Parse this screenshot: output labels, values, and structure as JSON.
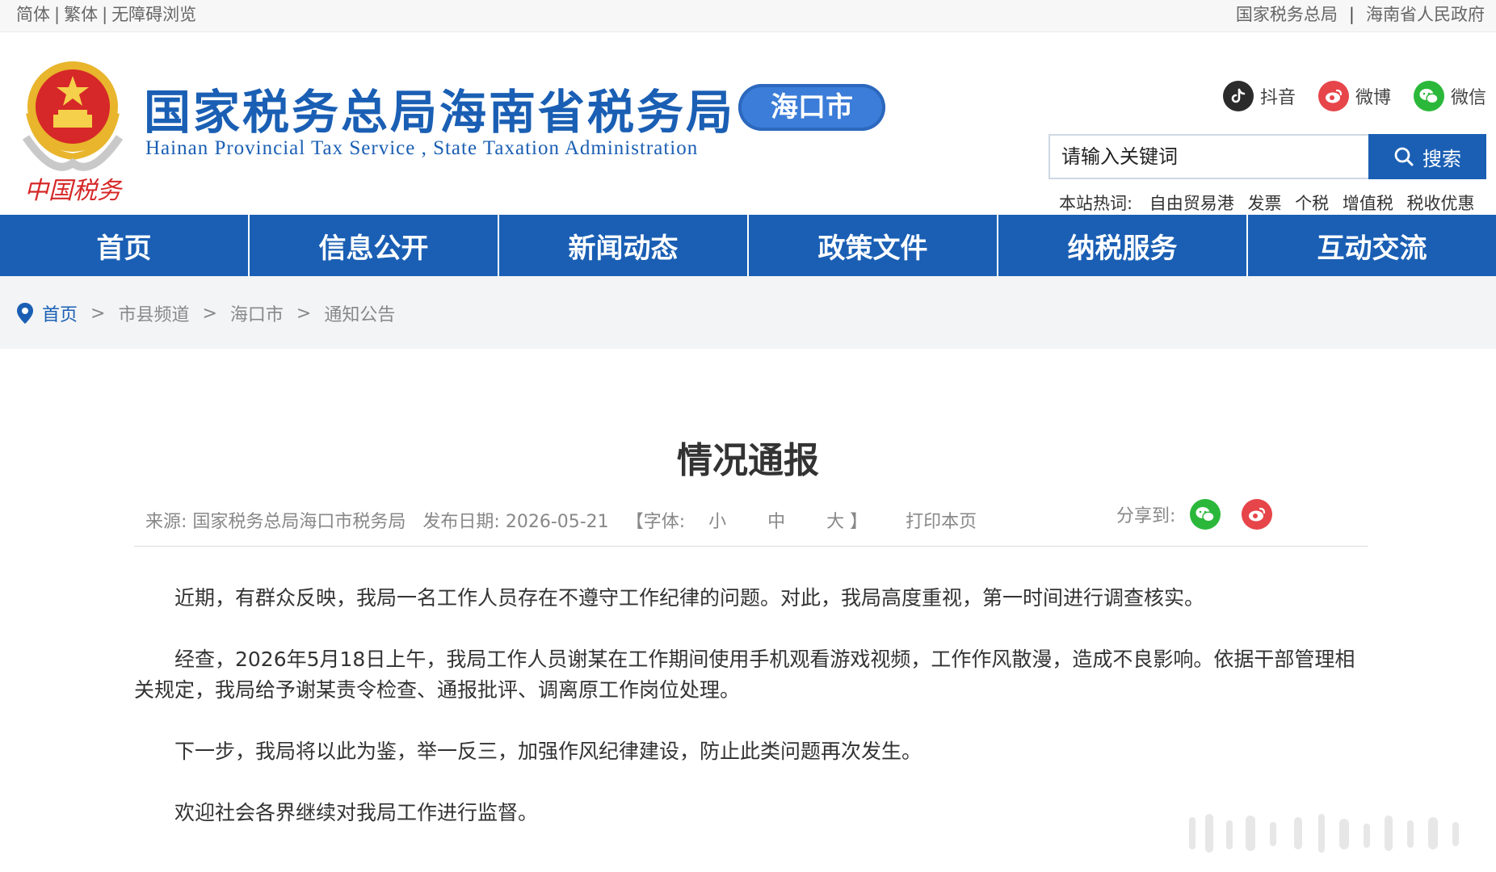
{
  "topbar": {
    "simplified": "简体",
    "traditional": "繁体",
    "accessible": "无障碍浏览",
    "separator": "|",
    "link_state_tax": "国家税务总局",
    "link_hainan_gov": "海南省人民政府"
  },
  "header": {
    "emblem_caption": "中国税务",
    "title": "国家税务总局海南省税务局",
    "subtitle_en": "Hainan  Provincial  Tax  Service ,  State  Taxation  Administration",
    "city_badge": "海口市"
  },
  "social": {
    "douyin": "抖音",
    "weibo": "微博",
    "weixin": "微信"
  },
  "search": {
    "placeholder": "请输入关键词",
    "button": "搜索"
  },
  "hotwords": {
    "label": "本站热词:",
    "items": [
      "自由贸易港",
      "发票",
      "个税",
      "增值税",
      "税收优惠"
    ]
  },
  "nav": {
    "items": [
      "首页",
      "信息公开",
      "新闻动态",
      "政策文件",
      "纳税服务",
      "互动交流"
    ]
  },
  "breadcrumb": {
    "home": "首页",
    "arrow": ">",
    "items": [
      "市县频道",
      "海口市",
      "通知公告"
    ]
  },
  "article": {
    "title": "情况通报",
    "source": "来源: 国家税务总局海口市税务局",
    "date": "发布日期: 2026-05-21",
    "font_label_open": "【字体:",
    "font_small": "小",
    "font_medium": "中",
    "font_large": "大",
    "font_label_close": "】",
    "print": "打印本页",
    "share_label": "分享到:",
    "paragraphs": [
      "近期，有群众反映，我局一名工作人员存在不遵守工作纪律的问题。对此，我局高度重视，第一时间进行调查核实。",
      "经查，2026年5月18日上午，我局工作人员谢某在工作期间使用手机观看游戏视频，工作作风散漫，造成不良影响。依据干部管理相关规定，我局给予谢某责令检查、通报批评、调离原工作岗位处理。",
      "下一步，我局将以此为鉴，举一反三，加强作风纪律建设，防止此类问题再次发生。",
      "欢迎社会各界继续对我局工作进行监督。"
    ]
  },
  "colors": {
    "brand_blue": "#1a5fb4",
    "badge_blue": "#3b7dd8",
    "emblem_red": "#d62828",
    "emblem_gold": "#e8b52c",
    "wechat_green": "#2bb83a",
    "weibo_red": "#e6454a"
  },
  "icons": {
    "emblem": "national-emblem-icon",
    "douyin": "douyin-icon",
    "weibo": "weibo-icon",
    "weixin": "wechat-icon",
    "search": "search-icon",
    "location": "location-pin-icon"
  }
}
